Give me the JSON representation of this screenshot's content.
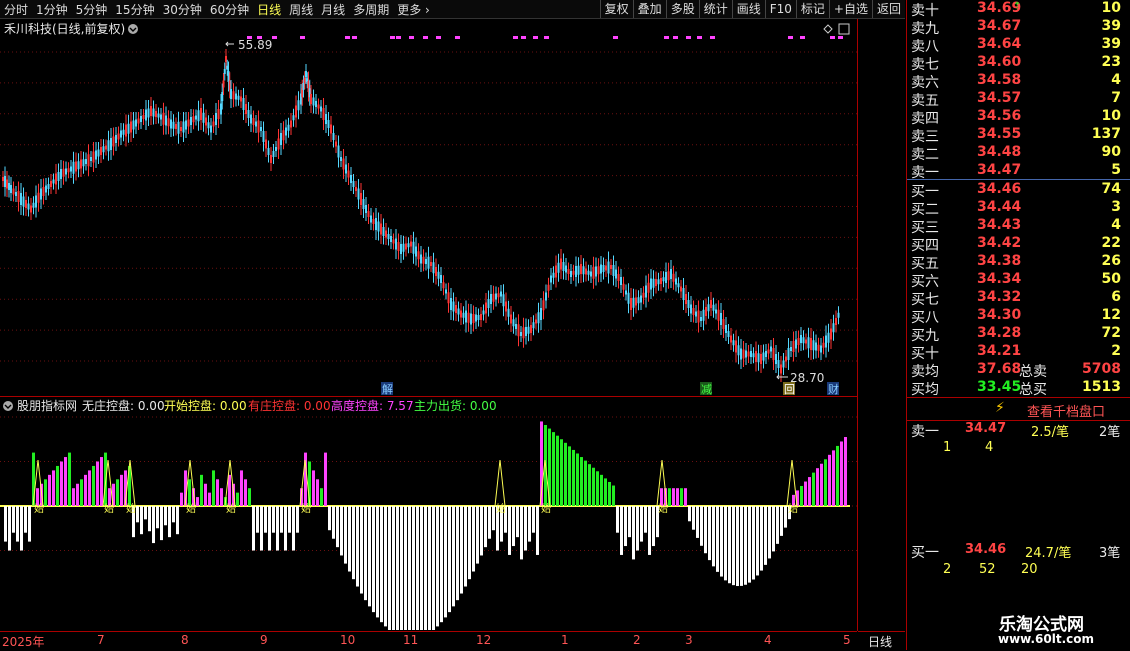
{
  "toolbar": {
    "left": [
      "分时",
      "1分钟",
      "5分钟",
      "15分钟",
      "30分钟",
      "60分钟",
      "日线",
      "周线",
      "月线",
      "多周期",
      "更多"
    ],
    "active": "日线",
    "right": [
      "复权",
      "叠加",
      "多股",
      "统计",
      "画线",
      "F10",
      "标记",
      "+自选",
      "返回"
    ]
  },
  "main_chart": {
    "title": "禾川科技(日线,前复权)",
    "high_label": "55.89",
    "low_label": "28.70",
    "event_labels": [
      "解",
      "减",
      "回",
      "财"
    ],
    "y_ticks": [
      "55.00",
      "52.50",
      "50.00",
      "47.50",
      "45.00",
      "42.50",
      "40.00",
      "37.50",
      "35.00",
      "32.50",
      "30.00"
    ]
  },
  "indicator": {
    "name": "股朋指标网",
    "items": [
      {
        "label": "无庄控盘: 0.00",
        "color": "#e8e8e8"
      },
      {
        "label": "开始控盘: 0.00",
        "color": "#ffff54"
      },
      {
        "label": "有庄控盘: 0.00",
        "color": "#ff3333"
      },
      {
        "label": "高度控盘: 7.57",
        "color": "#ff44ff"
      },
      {
        "label": "主力出货: 0.00",
        "color": "#44ff44"
      }
    ],
    "y_ticks": [
      "10.00",
      "5.00",
      "0.00",
      "-5.00"
    ],
    "marker_glyph": "始"
  },
  "x_axis": [
    "2025年",
    "7",
    "8",
    "9",
    "10",
    "11",
    "12",
    "1",
    "2",
    "3",
    "4",
    "5"
  ],
  "period_label": "日线",
  "order_book": {
    "asks": [
      {
        "label": "卖十",
        "price": "34.69",
        "vol": "10"
      },
      {
        "label": "卖九",
        "price": "34.67",
        "vol": "39"
      },
      {
        "label": "卖八",
        "price": "34.64",
        "vol": "39"
      },
      {
        "label": "卖七",
        "price": "34.60",
        "vol": "23"
      },
      {
        "label": "卖六",
        "price": "34.58",
        "vol": "4"
      },
      {
        "label": "卖五",
        "price": "34.57",
        "vol": "7"
      },
      {
        "label": "卖四",
        "price": "34.56",
        "vol": "10"
      },
      {
        "label": "卖三",
        "price": "34.55",
        "vol": "137"
      },
      {
        "label": "卖二",
        "price": "34.48",
        "vol": "90"
      },
      {
        "label": "卖一",
        "price": "34.47",
        "vol": "5"
      }
    ],
    "bids": [
      {
        "label": "买一",
        "price": "34.46",
        "vol": "74"
      },
      {
        "label": "买二",
        "price": "34.44",
        "vol": "3"
      },
      {
        "label": "买三",
        "price": "34.43",
        "vol": "4"
      },
      {
        "label": "买四",
        "price": "34.42",
        "vol": "22"
      },
      {
        "label": "买五",
        "price": "34.38",
        "vol": "26"
      },
      {
        "label": "买六",
        "price": "34.34",
        "vol": "50"
      },
      {
        "label": "买七",
        "price": "34.32",
        "vol": "6"
      },
      {
        "label": "买八",
        "price": "34.30",
        "vol": "12"
      },
      {
        "label": "买九",
        "price": "34.28",
        "vol": "72"
      },
      {
        "label": "买十",
        "price": "34.21",
        "vol": "2"
      }
    ],
    "avg_sell_label": "卖均",
    "avg_sell": "37.68",
    "total_sell_label": "总卖",
    "total_sell": "5708",
    "avg_buy_label": "买均",
    "avg_buy": "33.45",
    "total_buy_label": "总买",
    "total_buy": "1513",
    "depth_button": "查看千档盘口",
    "ask1": {
      "label": "卖一",
      "price": "34.47",
      "avg": "2.5/笔",
      "count": "2笔",
      "details": [
        "1",
        "4"
      ]
    },
    "bid1": {
      "label": "买一",
      "price": "34.46",
      "avg": "24.7/笔",
      "count": "3笔",
      "details": [
        "2",
        "52",
        "20"
      ]
    }
  },
  "watermark": {
    "title": "乐淘公式网",
    "url": "www.60lt.com"
  },
  "colors": {
    "up": "#ff3333",
    "down": "#54d8ff",
    "panel_border": "#aa0000",
    "highlight": "#ffff54",
    "magenta": "#ff44ff",
    "green": "#22ee22"
  }
}
